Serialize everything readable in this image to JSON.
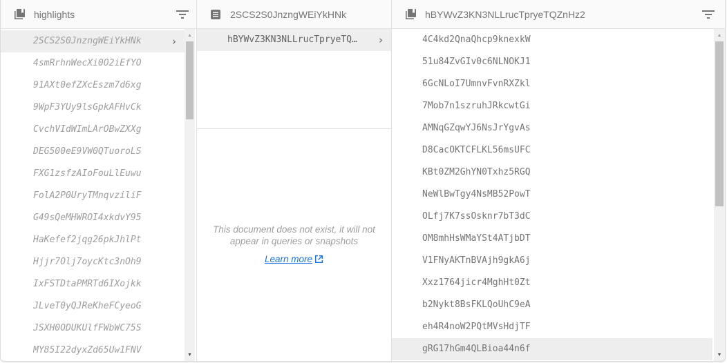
{
  "colors": {
    "link": "#1a73e8",
    "selected_row": "#eeeeee",
    "header_bg": "#fafafa"
  },
  "panels": {
    "collection": {
      "icon": "collection-icon",
      "title": "highlights",
      "filter_icon": "filter-icon",
      "selected_index": 0,
      "items": [
        "2SCS2S0JnzngWEiYkHNk",
        "4smRrhnWecXi0O2iEfYO",
        "91AXt0efZXcEszm7d6xg",
        "9WpF3YUy9lsGpkAFHvCk",
        "CvchVIdWImLArOBwZXXg",
        "DEG500eE9VW0QTuoroLS",
        "FXG1zsfzAIoFouLlEuwu",
        "FolA2P0UryTMnqvziliF",
        "G49sQeMHWROI4xkdvY95",
        "HaKefef2jqg26pkJhlPt",
        "Hjjr7Olj7oycKtc3nOh9",
        "IxFSTDtaPMRTd6IXojkk",
        "JLveT0yQJReKheFCyeoG",
        "JSXH0ODUKUlfFWbWC75S",
        "MY85I22dyxZd65Uw1FNV"
      ]
    },
    "document": {
      "icon": "document-icon",
      "title": "2SCS2S0JnzngWEiYkHNk",
      "subcollection": "hBYWvZ3KN3NLLrucTpryeTQZnHz2",
      "subcollection_display": "hBYWvZ3KN3NLLrucTpryeTQ…",
      "empty_message": "This document does not exist, it will not appear in queries or snapshots",
      "learn_more": "Learn more"
    },
    "subcollection": {
      "icon": "collection-icon",
      "title": "hBYWvZ3KN3NLLrucTpryeTQZnHz2",
      "filter_icon": "filter-icon",
      "selected_index": 14,
      "items": [
        "4C4kd2QnaQhcp9knexkW",
        "51u84ZvGIv0c6NLNOKJ1",
        "6GcNLoI7UmnvFvnRXZkl",
        "7Mob7n1szruhJRkcwtGi",
        "AMNqGZqwYJ6NsJrYgvAs",
        "D8CacOKTCFLKL56msUFC",
        "KBt0ZM2GhYN0Txhz5RGQ",
        "NeWlBwTgy4NsMB52PowT",
        "OLfj7K7ssOsknr7bT3dC",
        "OM8mhHsWMaYSt4ATjbDT",
        "V1FNyAKTnBVAjh9gkA6j",
        "Xxz1764jicr4MghHt0Zt",
        "b2Nykt8BsFKLQoUhC9eA",
        "eh4R4noW2PQtMVsHdjTF",
        "gRG17hGm4QLBioa44n6f"
      ]
    }
  }
}
